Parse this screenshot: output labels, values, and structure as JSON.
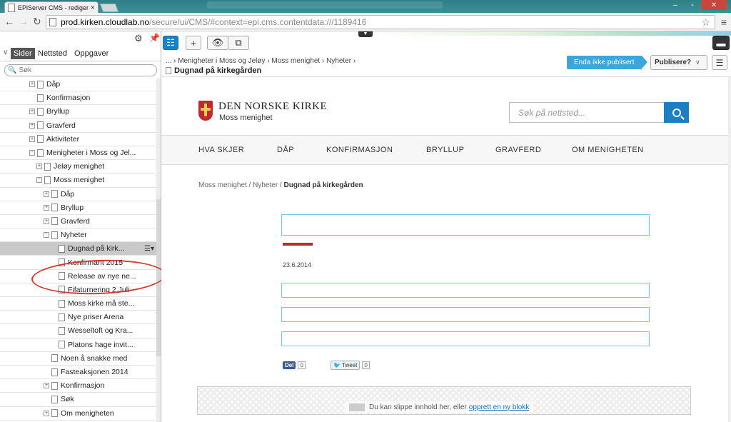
{
  "browser": {
    "tab_title": "EPiServer CMS - rediger",
    "url_host": "prod.kirken.cloudlab.no",
    "url_path": "/secure/ui/CMS/#context=epi.cms.contentdata:///1189416"
  },
  "left_panel": {
    "tabs": [
      "Sider",
      "Nettsted",
      "Oppgaver"
    ],
    "search_placeholder": "Søk",
    "tree": [
      {
        "label": "Dåp",
        "level": 0,
        "expander": "+"
      },
      {
        "label": "Konfirmasjon",
        "level": 0,
        "expander": ""
      },
      {
        "label": "Bryllup",
        "level": 0,
        "expander": "+"
      },
      {
        "label": "Gravferd",
        "level": 0,
        "expander": "+"
      },
      {
        "label": "Aktiviteter",
        "level": 0,
        "expander": "+"
      },
      {
        "label": "Menigheter i Moss og Jel...",
        "level": 0,
        "expander": "-"
      },
      {
        "label": "Jeløy menighet",
        "level": 1,
        "expander": "+"
      },
      {
        "label": "Moss menighet",
        "level": 1,
        "expander": "-"
      },
      {
        "label": "Dåp",
        "level": 2,
        "expander": "+"
      },
      {
        "label": "Bryllup",
        "level": 2,
        "expander": "+"
      },
      {
        "label": "Gravferd",
        "level": 2,
        "expander": "+"
      },
      {
        "label": "Nyheter",
        "level": 2,
        "expander": "-"
      },
      {
        "label": "Dugnad på kirk...",
        "level": 3,
        "expander": "",
        "selected": true
      },
      {
        "label": "Konfirmant 2015",
        "level": 3,
        "expander": ""
      },
      {
        "label": "Release av nye ne...",
        "level": 3,
        "expander": ""
      },
      {
        "label": "Fifaturnering 2.Juli",
        "level": 3,
        "expander": ""
      },
      {
        "label": "Moss kirke må ste...",
        "level": 3,
        "expander": ""
      },
      {
        "label": "Nye priser Arena",
        "level": 3,
        "expander": ""
      },
      {
        "label": "Wesseltoft og Kra...",
        "level": 3,
        "expander": ""
      },
      {
        "label": "Platons hage invit...",
        "level": 3,
        "expander": ""
      },
      {
        "label": "Noen å snakke med",
        "level": 2,
        "expander": ""
      },
      {
        "label": "Fasteaksjonen 2014",
        "level": 2,
        "expander": ""
      },
      {
        "label": "Konfirmasjon",
        "level": 2,
        "expander": "+"
      },
      {
        "label": "Søk",
        "level": 2,
        "expander": ""
      },
      {
        "label": "Om menigheten",
        "level": 2,
        "expander": "+"
      }
    ]
  },
  "toolbar": {
    "breadcrumb": "... › Menigheter i Moss og Jeløy › Moss menighet › Nyheter ›",
    "page_title": "Dugnad på kirkegården",
    "status": "Enda ikke publisert",
    "publish_label": "Publisere?"
  },
  "site": {
    "logo_title": "DEN NORSKE KIRKE",
    "logo_subtitle": "Moss menighet",
    "search_placeholder": "Søk på nettsted...",
    "nav": [
      "HVA SKJER",
      "DÅP",
      "KONFIRMASJON",
      "BRYLLUP",
      "GRAVFERD",
      "OM MENIGHETEN"
    ],
    "crumb_prefix": "Moss menighet / Nyheter / ",
    "crumb_current": "Dugnad på kirkegården",
    "date": "23.6.2014",
    "fb_label": "Del",
    "fb_count": "0",
    "tweet_label": "Tweet",
    "tweet_count": "0",
    "dropzone_text": "Du kan slippe innhold her, eller",
    "dropzone_link": "opprett en ny blokk"
  },
  "colors": {
    "accent_blue": "#1b82c5",
    "status_blue": "#3aa6dc",
    "brand_red": "#c3262f",
    "annotation_red": "#d03a2c"
  }
}
